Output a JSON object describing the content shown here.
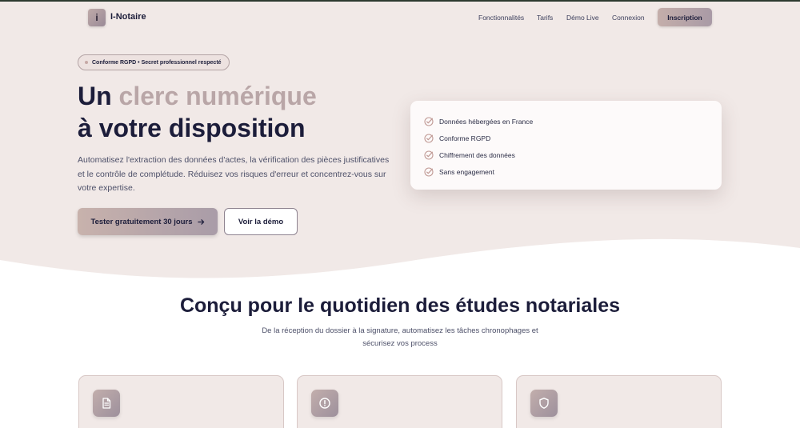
{
  "brand": {
    "logo_letter": "i",
    "name": "I-Notaire"
  },
  "nav": {
    "links": [
      "Fonctionnalités",
      "Tarifs",
      "Démo Live",
      "Connexion"
    ],
    "cta": "Inscription"
  },
  "hero": {
    "badge": "Conforme RGPD • Secret professionnel respecté",
    "headline_part1": "Un ",
    "headline_accent": "clerc numérique",
    "headline_part2": "à votre disposition",
    "description": "Automatisez l'extraction des données d'actes, la vérification des pièces justificatives et le contrôle de complétude. Réduisez vos risques d'erreur et concentrez-vous sur votre expertise.",
    "primary_button": "Tester gratuitement 30 jours",
    "secondary_button": "Voir la démo"
  },
  "features_card": {
    "items": [
      "Données hébergées en France",
      "Conforme RGPD",
      "Chiffrement des données",
      "Sans engagement"
    ]
  },
  "section": {
    "title": "Conçu pour le quotidien des études notariales",
    "subtitle": "De la réception du dossier à la signature, automatisez les tâches chronophages et sécurisez vos process"
  },
  "cards": [
    {
      "icon": "document-icon"
    },
    {
      "icon": "alert-circle-icon"
    },
    {
      "icon": "shield-icon"
    }
  ],
  "colors": {
    "hero_background": "#f1e9e7",
    "text_dark": "#1c1d3a",
    "accent": "#b9a6a7",
    "check": "#c09a95"
  }
}
